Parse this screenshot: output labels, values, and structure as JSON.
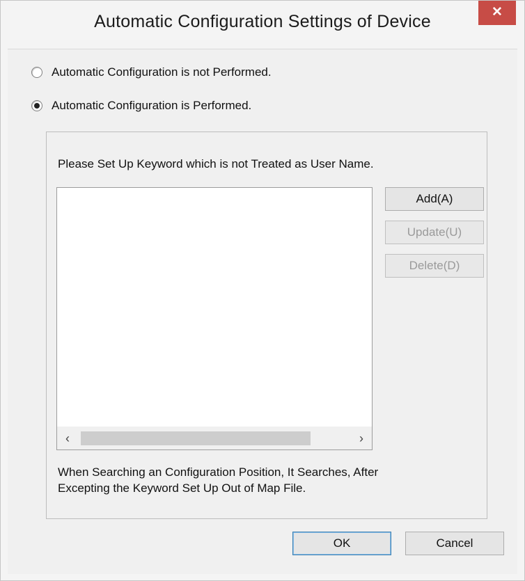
{
  "window": {
    "title": "Automatic Configuration Settings of Device",
    "close_label": "✕"
  },
  "options": {
    "not_performed_label": "Automatic Configuration is not Performed.",
    "performed_label": "Automatic Configuration is Performed.",
    "selected": "performed"
  },
  "keywords": {
    "instruction": "Please Set Up Keyword which is not Treated as User Name.",
    "items": [],
    "add_label": "Add(A)",
    "update_label": "Update(U)",
    "delete_label": "Delete(D)",
    "note_line1": "When Searching an Configuration Position, It Searches, After",
    "note_line2": "Excepting the Keyword Set Up Out of Map File.",
    "scroll_left": "‹",
    "scroll_right": "›"
  },
  "footer": {
    "ok_label": "OK",
    "cancel_label": "Cancel"
  }
}
